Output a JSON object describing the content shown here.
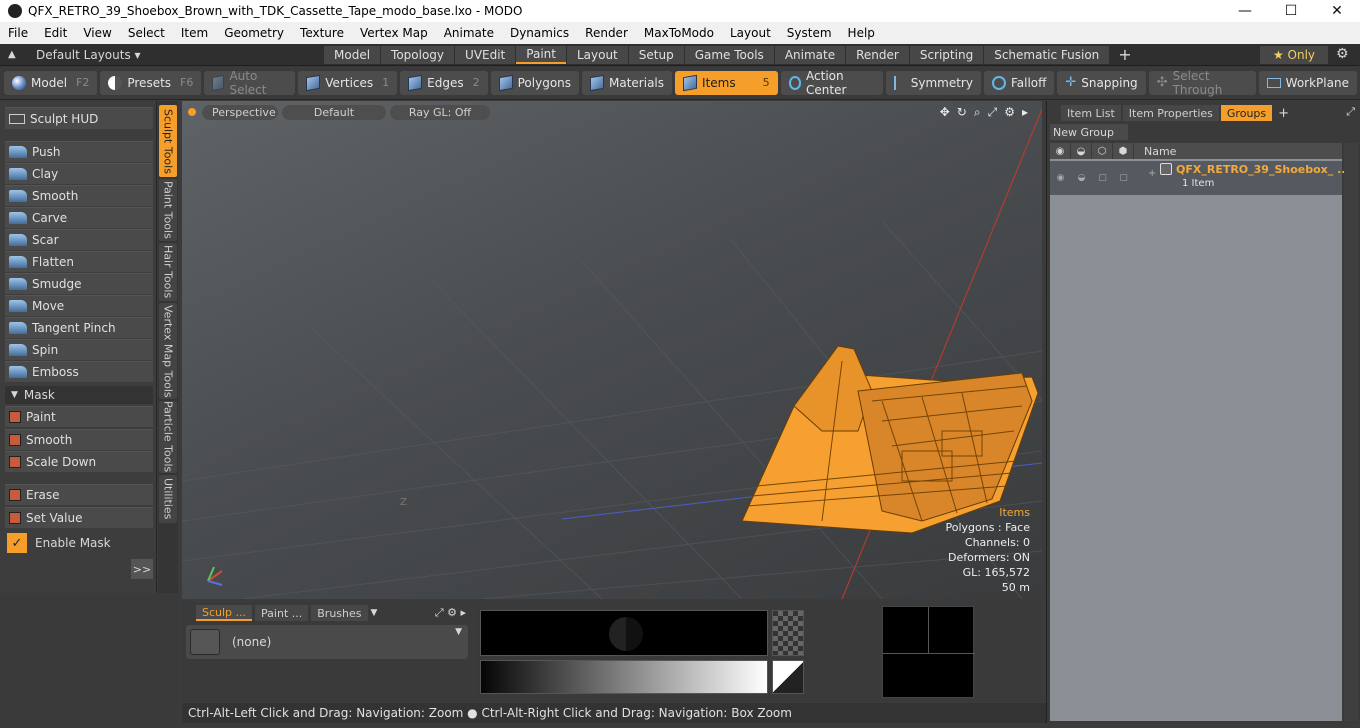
{
  "window": {
    "title": "QFX_RETRO_39_Shoebox_Brown_with_TDK_Cassette_Tape_modo_base.lxo - MODO",
    "minimize": "—",
    "maximize": "☐",
    "close": "✕"
  },
  "menu": [
    "File",
    "Edit",
    "View",
    "Select",
    "Item",
    "Geometry",
    "Texture",
    "Vertex Map",
    "Animate",
    "Dynamics",
    "Render",
    "MaxToModo",
    "Layout",
    "System",
    "Help"
  ],
  "layoutbar": {
    "layouts_label": "Default Layouts ▾",
    "tabs": [
      "Model",
      "Topology",
      "UVEdit",
      "Paint",
      "Layout",
      "Setup",
      "Game Tools",
      "Animate",
      "Render",
      "Scripting",
      "Schematic Fusion"
    ],
    "active_tab": "Paint",
    "add": "+",
    "only_label": "★ Only",
    "gear": "⚙"
  },
  "toolbar": {
    "model": "Model",
    "model_key": "F2",
    "presets": "Presets",
    "presets_key": "F6",
    "auto_select": "Auto Select",
    "vertices": "Vertices",
    "vertices_key": "1",
    "edges": "Edges",
    "edges_key": "2",
    "polygons": "Polygons",
    "materials": "Materials",
    "items": "Items",
    "items_key": "5",
    "action_center": "Action Center",
    "symmetry": "Symmetry",
    "falloff": "Falloff",
    "snapping": "Snapping",
    "select_through": "Select Through",
    "workplane": "WorkPlane"
  },
  "leftpanel": {
    "sculpt_hud": "Sculpt HUD",
    "tools": [
      "Push",
      "Clay",
      "Smooth",
      "Carve",
      "Scar",
      "Flatten",
      "Smudge",
      "Move",
      "Tangent Pinch",
      "Spin",
      "Emboss"
    ],
    "mask_label": "Mask",
    "mask_tools": [
      "Paint",
      "Smooth",
      "Scale Down"
    ],
    "erase": "Erase",
    "set_value": "Set Value",
    "enable_mask": "Enable Mask",
    "expand": ">>"
  },
  "vtabs": [
    "Sculpt Tools",
    "Paint Tools",
    "Hair Tools",
    "Vertex Map Tools",
    "Particle Tools",
    "Utilities"
  ],
  "viewport": {
    "view": "Perspective",
    "shading": "Default",
    "raygl": "Ray GL: Off",
    "axis_label": "Z",
    "info": {
      "items": "Items",
      "polygons": "Polygons : Face",
      "channels": "Channels: 0",
      "deformers": "Deformers: ON",
      "gl": "GL: 165,572",
      "scale": "50 m"
    }
  },
  "rightpanel": {
    "tabs": [
      "Item List",
      "Item Properties",
      "Groups"
    ],
    "active_tab": "Groups",
    "add": "+",
    "new_group": "New Group",
    "name_header": "Name",
    "group_name": "QFX_RETRO_39_Shoebox_ ...",
    "group_count": "1 Item"
  },
  "bottom": {
    "tabs": [
      "Sculp ...",
      "Paint ...",
      "Brushes"
    ],
    "brush_value": "(none)"
  },
  "status": "Ctrl-Alt-Left Click and Drag: Navigation: Zoom ● Ctrl-Alt-Right Click and Drag: Navigation: Box Zoom",
  "colors": {
    "accent": "#f59f2a",
    "wire": "#f5a93a"
  }
}
